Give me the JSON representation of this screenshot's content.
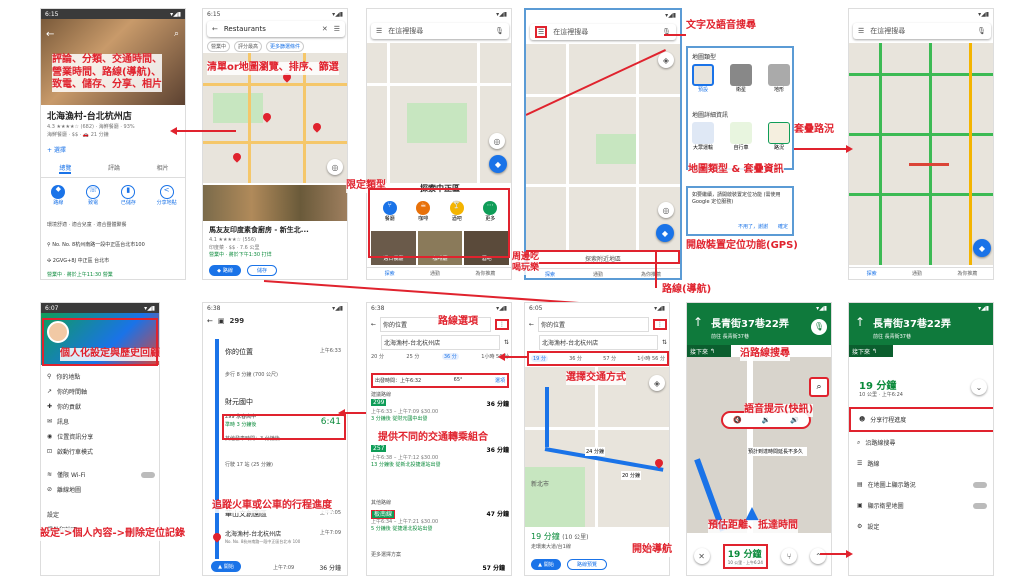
{
  "ann": {
    "place_detail": "評論、分類、交通時間、\n營業時間、路線(導航)、\n致電、儲存、分享、相片",
    "list_sort": "清單or地圖瀏覽、排序、篩選",
    "filter_type": "限定類型",
    "text_voice": "文字及語音搜尋",
    "overlay_traffic": "套疊路況",
    "map_types": "地圖類型 & 套疊資訊",
    "gps": "開啟裝置定位功能(GPS)",
    "nearby": "周邊吃\n喝玩樂",
    "route_nav": "路線(導航)",
    "personal": "個人化設定與歷史回顧",
    "settings_path": "設定->個人內容->刪除定位記錄",
    "trip_progress": "追蹤火車或公車的行程進度",
    "route_options": "路線選項",
    "transport_combo": "提供不同的交通轉乘組合",
    "choose_mode": "選擇交通方式",
    "search_along": "沿路線搜尋",
    "voice_prompt": "語音提示(快訊)",
    "est_time": "預估距離、抵達時間",
    "start_nav": "開始導航"
  },
  "p1": {
    "time": "6:15",
    "name": "北海漁村-台北杭州店",
    "rating": "4.3 ★★★★☆ (682) · 海鮮餐廳 · 93%",
    "meta": "海鮮餐廳 · $$ · 🚗 21 分鐘",
    "add_list": "+ 選擇",
    "tabs": [
      "總覽",
      "評論",
      "相片"
    ],
    "actions": [
      "路線",
      "致電",
      "已儲存",
      "分享地點"
    ],
    "address": "No. No. 8杭州南路一段中正區台北市100",
    "plus": "2GVG+8J 中正區 台北市",
    "hours": "營業中 · 將於上午11:30 營業",
    "food": "環境舒適 · 適合兒童 · 適合團體聚餐"
  },
  "p2": {
    "time": "6:15",
    "query": "Restaurants",
    "chips": [
      "營業中",
      "評分最高",
      "更多篩選條件"
    ],
    "place": "馬友友印度素食廚房 - 新生北...",
    "rating": "4.1 ★★★★☆ (556)",
    "meta": "印度菜 · $$ · 7.6 公里",
    "status": "營業中 · 將於下午1:30 打烊",
    "btn_route": "路線",
    "btn_save": "儲存"
  },
  "p3": {
    "search": "在這裡搜尋",
    "district": "探索中正區",
    "cats": [
      "餐廳",
      "咖啡",
      "酒吧",
      "更多"
    ],
    "photos": [
      "週日餐廳",
      "咖啡廳",
      "酒吧"
    ],
    "tabs": [
      "探索",
      "通勤",
      "為你推薦"
    ]
  },
  "p4": {
    "search": "在這裡搜尋",
    "layers_title": "地圖類型",
    "types": [
      "預設",
      "衛星",
      "地形"
    ],
    "details_title": "地圖詳細資訊",
    "details": [
      "大眾運輸",
      "自行車",
      "路況"
    ],
    "gps_text": "如要繼續，請開啟裝置定位功能 (需使用 Google 定位服務)",
    "gps_no": "不用了，謝謝",
    "gps_ok": "確定",
    "nearby": "探索附近地區",
    "tabs": [
      "探索",
      "通勤",
      "為你推薦"
    ]
  },
  "p5": {
    "search": "在這裡搜尋",
    "tabs": [
      "探索",
      "通勤",
      "為你推薦"
    ]
  },
  "p6": {
    "time": "6:07",
    "menu": [
      "你的地點",
      "你的時間軸",
      "你的貢獻",
      "訊息",
      "位置資訊分享",
      "啟動行車模式",
      "僅限 Wi-Fi",
      "離線地圖",
      "設定",
      "提供和說明"
    ]
  },
  "p7": {
    "time": "6:38",
    "bus": "299",
    "start": "你的位置",
    "start_time": "上午6:33",
    "walk": "步行 8 分鐘 (700 公尺)",
    "stop1": "財元國中",
    "route": "299 永春高中",
    "mins": "準時 3 分鐘後",
    "arr": "6:41",
    "other": "其他發車時間：3 分鐘後",
    "ride": "行駛 17 站 (25 分鐘)",
    "stop2": "華山文創園區",
    "stop2_time": "上午7:05",
    "dest": "北海漁村-台北杭州店",
    "dest_addr": "No. No. 8杭州南路一段中正區台北市 100",
    "dest_time": "上午7:09",
    "start_btn": "開始",
    "footer_time": "上午7:09",
    "footer_mins": "36 分鐘"
  },
  "p8": {
    "time": "6:38",
    "from": "你的位置",
    "to": "北海漁村-台北杭州店",
    "modes": [
      "20 分",
      "25 分",
      "36 分",
      "1小時 56 分"
    ],
    "depart": "出發時間：上午6:32",
    "temp": "65°",
    "options": "選項",
    "hdr1": "建議路線",
    "r1_time": "36 分鐘",
    "r1_sub": "上午6:33 – 上午7:09    $30.00",
    "r1_note": "3 分鐘後 從財元國中出發",
    "r2_time": "36 分鐘",
    "r2_sub": "上午6:38 – 上午7:12    $30.00",
    "r2_note": "13 分鐘後 從新北投捷運站出發",
    "hdr2": "其他路線",
    "r3_time": "47 分鐘",
    "r3_sub": "上午6:34 – 上午7:21    $30.00",
    "r3_note": "5 分鐘後 從捷運北投站出發",
    "hdr3": "更多選擇方案",
    "r4_time": "57 分鐘",
    "bus1": "299",
    "bus2": "257",
    "mrt": "板南線"
  },
  "p9": {
    "time": "6:05",
    "from": "你的位置",
    "to": "北海漁村-台北杭州店",
    "modes": [
      "19 分",
      "36 分",
      "57 分",
      "1小時 56 分"
    ],
    "alt1": "20 分鐘",
    "alt2": "24 分鐘",
    "city": "新北市",
    "dur": "19 分鐘",
    "dist": "(10 公里)",
    "via": "走環東大道/台1線",
    "start": "開始",
    "steps": "路線預覽"
  },
  "p10": {
    "street": "長青街37巷22弄",
    "sub": "前往 長青街37巷",
    "next": "接下來",
    "mins": "19 分鐘",
    "meta": "10 公里 · 上午6:24",
    "note": "預計到達時間延長不多久"
  },
  "p11": {
    "street": "長青街37巷22弄",
    "sub": "前往 長青街37巷",
    "next": "接下來",
    "mins": "19 分鐘",
    "meta": "10 公里 · 上午6:24",
    "items": [
      "分享行程進度",
      "沿路線搜尋",
      "路線",
      "在地圖上顯示路況",
      "顯示衛星地圖",
      "設定"
    ]
  }
}
